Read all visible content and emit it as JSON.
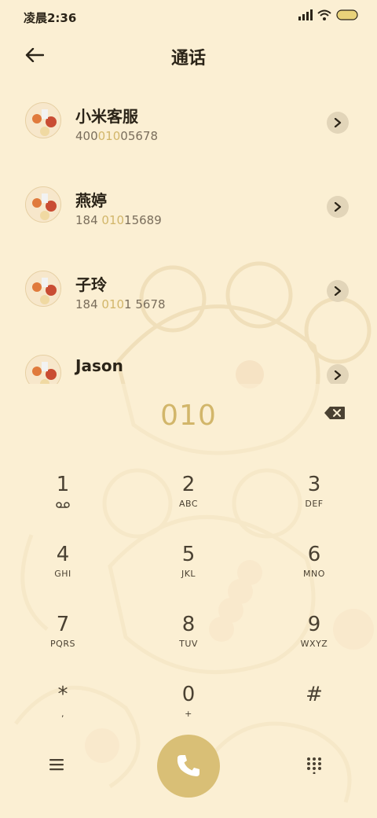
{
  "status_bar": {
    "time": "凌晨2:36",
    "icons": [
      "signal-icon",
      "wifi-icon",
      "battery-icon"
    ]
  },
  "header": {
    "title": "通话",
    "back_icon": "back-arrow-icon"
  },
  "contacts": [
    {
      "name": "小米客服",
      "number_pre": "400",
      "number_hl": "010",
      "number_post": "05678"
    },
    {
      "name": "燕婷",
      "number_pre": "184 ",
      "number_hl": "010",
      "number_post": "15689"
    },
    {
      "name": "子玲",
      "number_pre": "184 ",
      "number_hl": "010",
      "number_post": "1 5678"
    },
    {
      "name": "Jason",
      "number_pre": "",
      "number_hl": "",
      "number_post": ""
    }
  ],
  "dialer": {
    "input": "010",
    "keys": [
      {
        "digit": "1",
        "letters": ""
      },
      {
        "digit": "2",
        "letters": "ABC"
      },
      {
        "digit": "3",
        "letters": "DEF"
      },
      {
        "digit": "4",
        "letters": "GHI"
      },
      {
        "digit": "5",
        "letters": "JKL"
      },
      {
        "digit": "6",
        "letters": "MNO"
      },
      {
        "digit": "7",
        "letters": "PQRS"
      },
      {
        "digit": "8",
        "letters": "TUV"
      },
      {
        "digit": "9",
        "letters": "WXYZ"
      },
      {
        "digit": "*",
        "letters": ","
      },
      {
        "digit": "0",
        "letters": "+"
      },
      {
        "digit": "#",
        "letters": ""
      }
    ]
  },
  "colors": {
    "background": "#fbefd3",
    "accent": "#d2b66a",
    "call_button": "#d9bf76",
    "text": "#2b2418",
    "secondary_text": "#7a6e5c"
  }
}
